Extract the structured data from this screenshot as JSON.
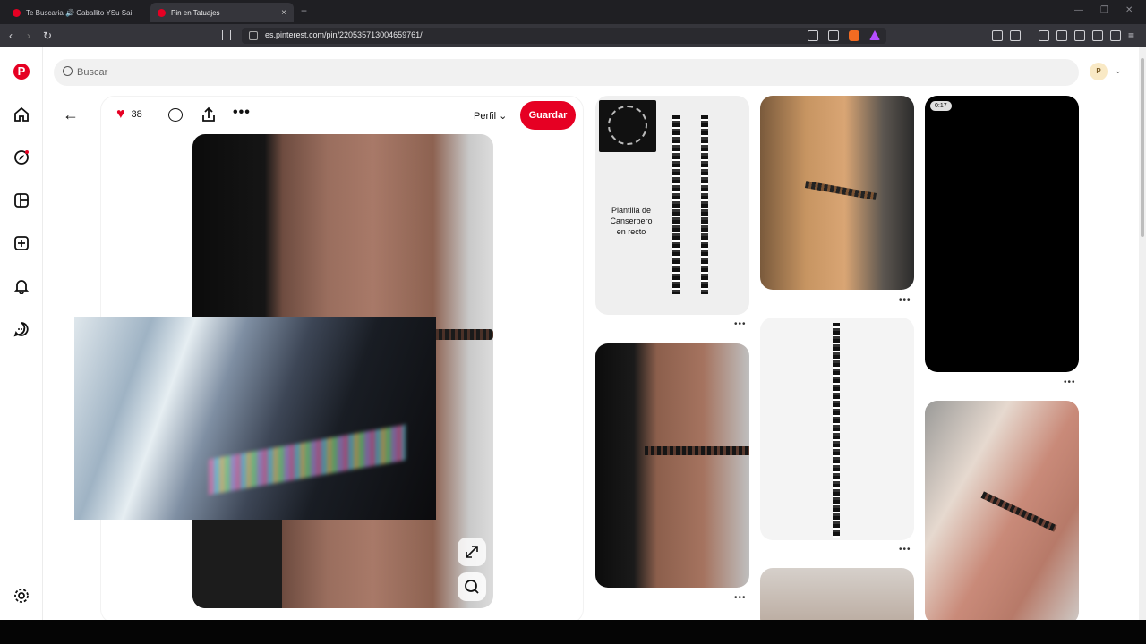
{
  "browser": {
    "tabs": [
      {
        "label": "Te Buscaria 🔊 Caballito YSu Sai",
        "active": false
      },
      {
        "label": "Pin en Tatuajes",
        "active": true
      }
    ],
    "url": "es.pinterest.com/pin/220535713004659761/"
  },
  "search": {
    "placeholder": "Buscar"
  },
  "account": {
    "initial": "P"
  },
  "pin": {
    "likes": "38",
    "profile_label": "Perfil",
    "save_label": "Guardar"
  },
  "grid": {
    "template_caption": "Plantilla de Canserbero en recto",
    "video_duration": "0:17",
    "more_label": "..."
  },
  "colors": {
    "brand": "#e60023"
  }
}
